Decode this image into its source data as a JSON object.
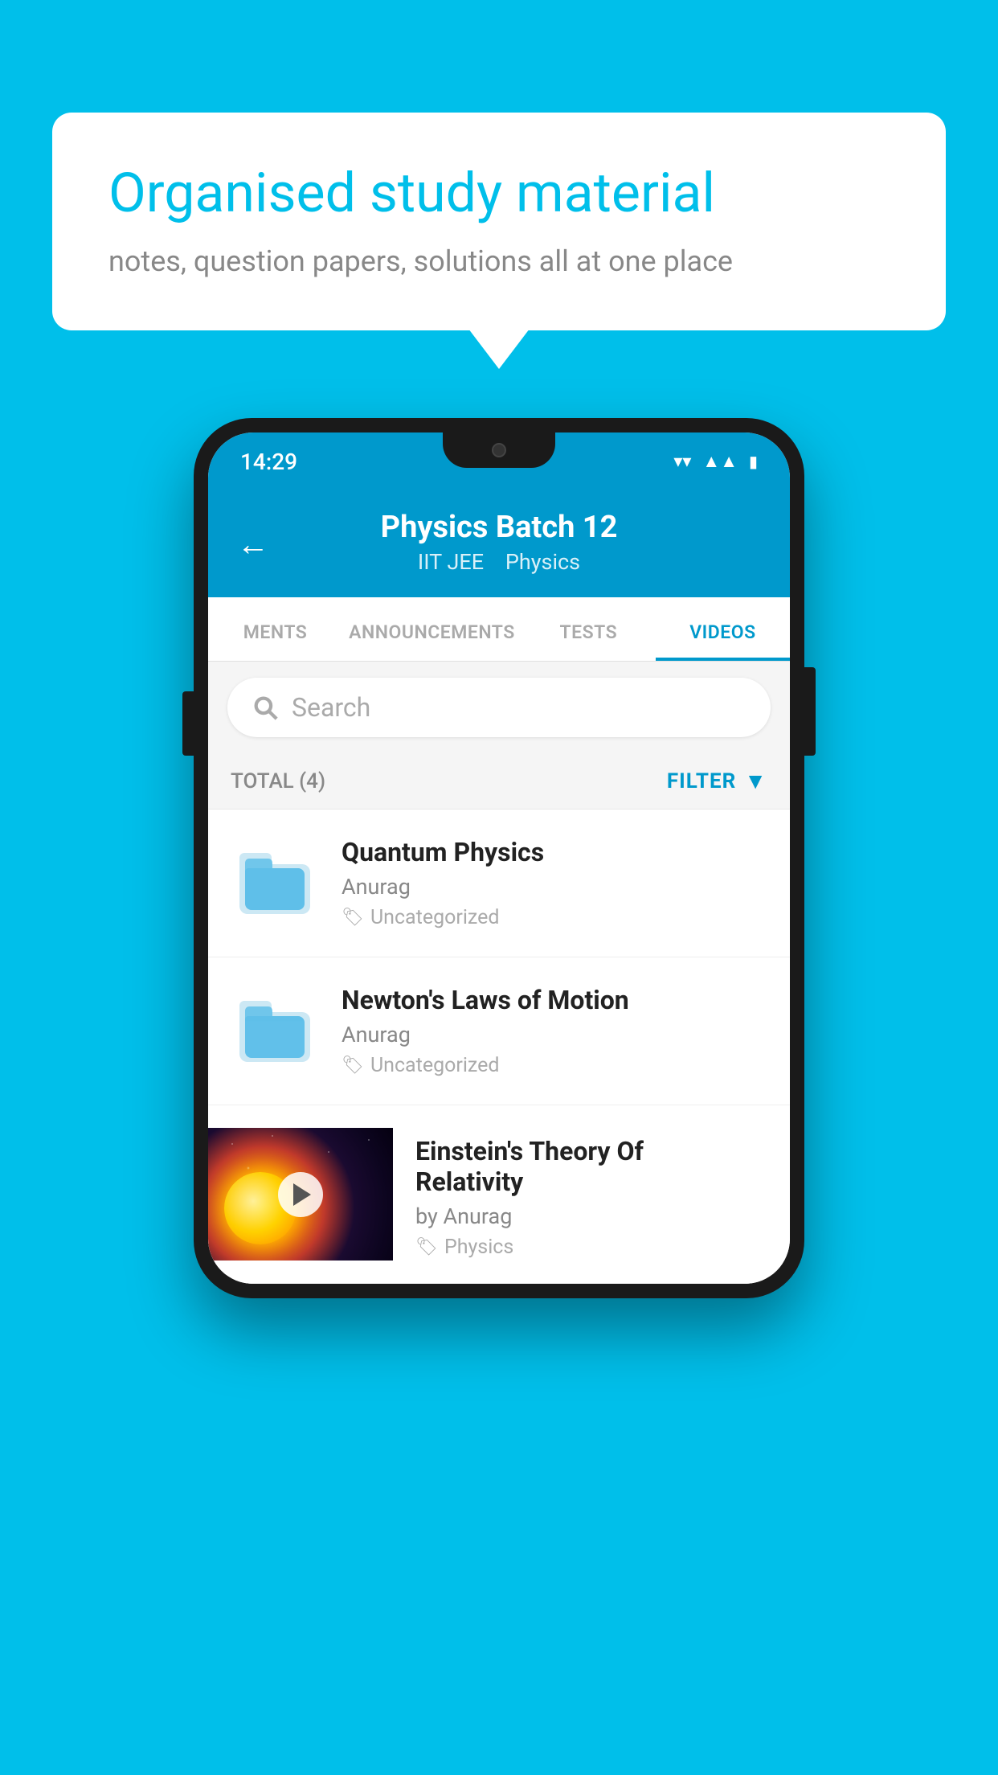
{
  "background_color": "#00BFEA",
  "speech_bubble": {
    "title": "Organised study material",
    "subtitle": "notes, question papers, solutions all at one place"
  },
  "phone": {
    "status_bar": {
      "time": "14:29"
    },
    "app_header": {
      "title": "Physics Batch 12",
      "subtitle_part1": "IIT JEE",
      "subtitle_part2": "Physics",
      "back_label": "←"
    },
    "tabs": [
      {
        "label": "MENTS",
        "active": false
      },
      {
        "label": "ANNOUNCEMENTS",
        "active": false
      },
      {
        "label": "TESTS",
        "active": false
      },
      {
        "label": "VIDEOS",
        "active": true
      }
    ],
    "search": {
      "placeholder": "Search"
    },
    "filter_row": {
      "total_label": "TOTAL (4)",
      "filter_label": "FILTER"
    },
    "videos": [
      {
        "title": "Quantum Physics",
        "author": "Anurag",
        "tag": "Uncategorized",
        "type": "folder"
      },
      {
        "title": "Newton's Laws of Motion",
        "author": "Anurag",
        "tag": "Uncategorized",
        "type": "folder"
      },
      {
        "title": "Einstein's Theory Of Relativity",
        "author": "by Anurag",
        "tag": "Physics",
        "type": "video"
      }
    ]
  }
}
